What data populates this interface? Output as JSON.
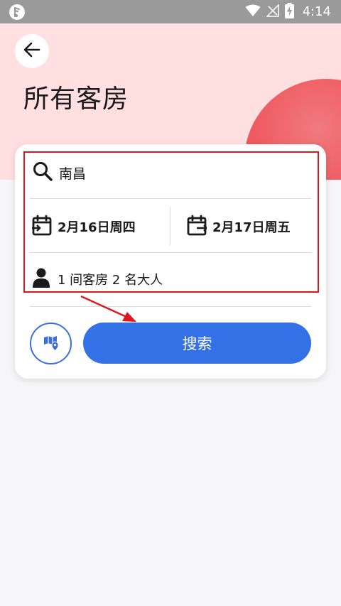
{
  "status_bar": {
    "time": "4:14",
    "icons": [
      "app-badge-icon",
      "wifi-icon",
      "no-signal-icon",
      "battery-charging-icon"
    ]
  },
  "header": {
    "back_icon": "arrow-left-icon",
    "title": "所有客房"
  },
  "search_form": {
    "city": {
      "icon": "search-icon",
      "value": "南昌"
    },
    "checkin": {
      "icon": "calendar-in-icon",
      "value": "2月16日周四"
    },
    "checkout": {
      "icon": "calendar-out-icon",
      "value": "2月17日周五"
    },
    "guests": {
      "icon": "person-icon",
      "value": "1 间客房 2 名大人"
    },
    "map_button_icon": "map-pin-icon",
    "search_label": "搜索"
  },
  "colors": {
    "accent": "#3471e6",
    "hero_bg": "#ffdfe0",
    "hero_blob": "#ef5a60",
    "annotation": "#e1161c",
    "status_bar": "#9a9a9a"
  }
}
